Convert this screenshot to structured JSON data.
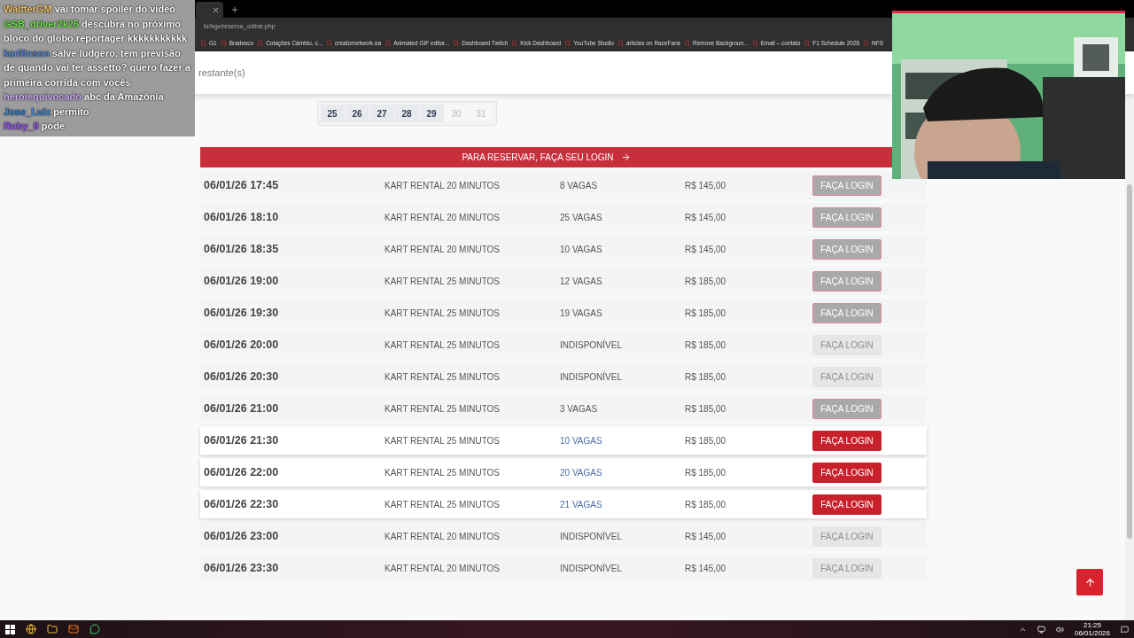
{
  "browser": {
    "url": "br/kgv/reserva_online.php",
    "bookmarks": [
      "G1",
      "Bradesco",
      "Cotações Câmbio, c...",
      "creatornetwork.ea",
      "Animated GIF editor...",
      "Dashboard Twitch",
      "Kick Dashboard",
      "YouTube Studio",
      "articles on RaceFans",
      "Remove Backgroun...",
      "Email – contato",
      "F1 Schedule 2026",
      "NFS"
    ]
  },
  "header": {
    "inactivity": "restante(s)"
  },
  "calendar": [
    {
      "day": "25",
      "disabled": false
    },
    {
      "day": "26",
      "disabled": false
    },
    {
      "day": "27",
      "disabled": false
    },
    {
      "day": "28",
      "disabled": false
    },
    {
      "day": "29",
      "disabled": false
    },
    {
      "day": "30",
      "disabled": true
    },
    {
      "day": "31",
      "disabled": true
    }
  ],
  "banner": "PARA RESERVAR, FAÇA SEU LOGIN",
  "sessions": [
    {
      "time": "06/01/26 17:45",
      "name": "KART RENTAL 20 MINUTOS",
      "spots": "8 VAGAS",
      "price": "R$ 145,00",
      "button": "FAÇA LOGIN",
      "kind": "restricted"
    },
    {
      "time": "06/01/26 18:10",
      "name": "KART RENTAL 20 MINUTOS",
      "spots": "25 VAGAS",
      "price": "R$ 145,00",
      "button": "FAÇA LOGIN",
      "kind": "restricted"
    },
    {
      "time": "06/01/26 18:35",
      "name": "KART RENTAL 20 MINUTOS",
      "spots": "10 VAGAS",
      "price": "R$ 145,00",
      "button": "FAÇA LOGIN",
      "kind": "restricted"
    },
    {
      "time": "06/01/26 19:00",
      "name": "KART RENTAL 25 MINUTOS",
      "spots": "12 VAGAS",
      "price": "R$ 185,00",
      "button": "FAÇA LOGIN",
      "kind": "restricted"
    },
    {
      "time": "06/01/26 19:30",
      "name": "KART RENTAL 25 MINUTOS",
      "spots": "19 VAGAS",
      "price": "R$ 185,00",
      "button": "FAÇA LOGIN",
      "kind": "restricted"
    },
    {
      "time": "06/01/26 20:00",
      "name": "KART RENTAL 25 MINUTOS",
      "spots": "INDISPONÍVEL",
      "price": "R$ 185,00",
      "button": "FAÇA LOGIN",
      "kind": "unavailable"
    },
    {
      "time": "06/01/26 20:30",
      "name": "KART RENTAL 25 MINUTOS",
      "spots": "INDISPONÍVEL",
      "price": "R$ 185,00",
      "button": "FAÇA LOGIN",
      "kind": "unavailable"
    },
    {
      "time": "06/01/26 21:00",
      "name": "KART RENTAL 25 MINUTOS",
      "spots": "3 VAGAS",
      "price": "R$ 185,00",
      "button": "FAÇA LOGIN",
      "kind": "restricted"
    },
    {
      "time": "06/01/26 21:30",
      "name": "KART RENTAL 25 MINUTOS",
      "spots": "10 VAGAS",
      "price": "R$ 185,00",
      "button": "FAÇA LOGIN",
      "kind": "available"
    },
    {
      "time": "06/01/26 22:00",
      "name": "KART RENTAL 25 MINUTOS",
      "spots": "20 VAGAS",
      "price": "R$ 185,00",
      "button": "FAÇA LOGIN",
      "kind": "available"
    },
    {
      "time": "06/01/26 22:30",
      "name": "KART RENTAL 25 MINUTOS",
      "spots": "21 VAGAS",
      "price": "R$ 185,00",
      "button": "FAÇA LOGIN",
      "kind": "available"
    },
    {
      "time": "06/01/26 23:00",
      "name": "KART RENTAL 20 MINUTOS",
      "spots": "INDISPONÍVEL",
      "price": "R$ 145,00",
      "button": "FAÇA LOGIN",
      "kind": "unavailable"
    },
    {
      "time": "06/01/26 23:30",
      "name": "KART RENTAL 20 MINUTOS",
      "spots": "INDISPONÍVEL",
      "price": "R$ 145,00",
      "button": "FAÇA LOGIN",
      "kind": "unavailable"
    }
  ],
  "chat": [
    {
      "user": "WaltterGM",
      "color": "#f2c46d",
      "message": "vai tomar spoiler do video"
    },
    {
      "user": "GSB_driver2k25",
      "color": "#72e84c",
      "message": "descubra no próximo bloco do globo reportager kkkkkkkkkkk"
    },
    {
      "user": "karllinson",
      "color": "#5b8ed8",
      "message": "salve ludgero, tem previsão de quando vai ter assetto? quero fazer a primeira corrida com vocês"
    },
    {
      "user": "heroiequivocado",
      "color": "#d4b0ff",
      "message": "abc da Amazônia"
    },
    {
      "user": "Jose_Luiz",
      "color": "#3f8be0",
      "message": "permito"
    },
    {
      "user": "Ruby_0",
      "color": "#9a5cf5",
      "message": "pode"
    }
  ],
  "taskbar": {
    "time": "21:25",
    "date": "06/01/2026"
  }
}
